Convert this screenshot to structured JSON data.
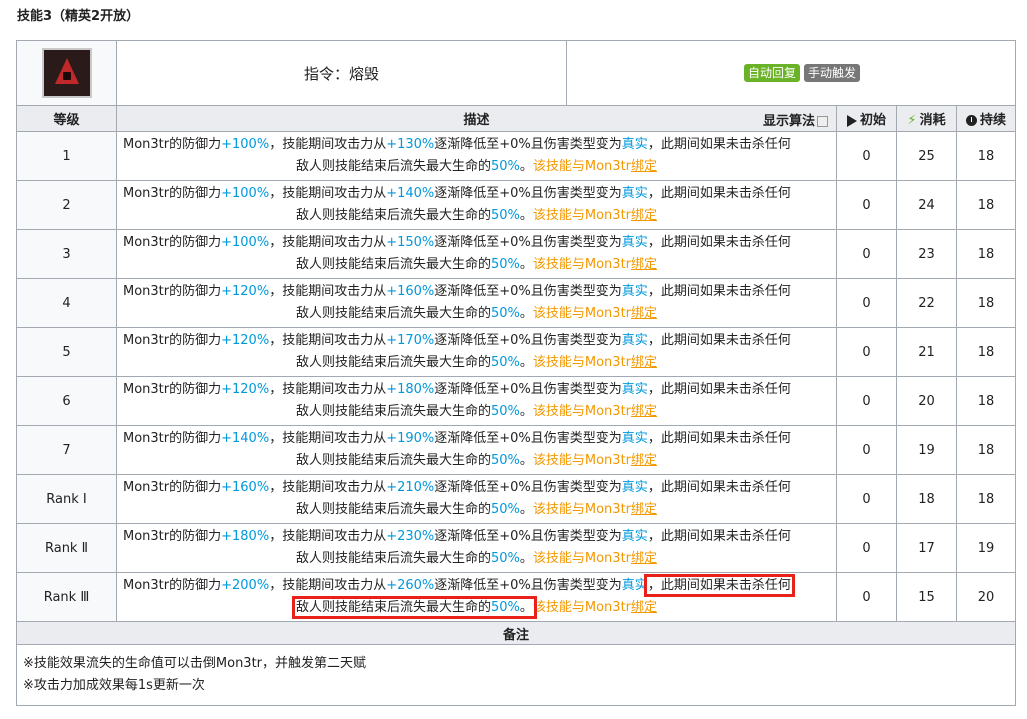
{
  "heading": "技能3（精英2开放）",
  "skill": {
    "name": "指令：熔毁",
    "tags": [
      "自动回复",
      "手动触发"
    ],
    "icon": "skill-meltdown-icon"
  },
  "columns": {
    "level": "等级",
    "description": "描述",
    "algo": "显示算法",
    "initial": "初始",
    "cost": "消耗",
    "duration": "持续"
  },
  "desc_parts": {
    "p1": "Mon3tr的防御力",
    "p2": "，技能期间攻击力从",
    "p3": "逐渐降低至+0%且伤害类型变为",
    "true_dmg": "真实",
    "p4": "，此期间如果未击杀任何",
    "p5": "敌人则技能结束后流失最大生命的",
    "pct": "50%",
    "p6": "。",
    "p7": "该技能与Mon3tr",
    "bind": "绑定"
  },
  "rows": [
    {
      "level": "1",
      "def": "+100%",
      "atk": "+130%",
      "initial": "0",
      "cost": "25",
      "duration": "18"
    },
    {
      "level": "2",
      "def": "+100%",
      "atk": "+140%",
      "initial": "0",
      "cost": "24",
      "duration": "18"
    },
    {
      "level": "3",
      "def": "+100%",
      "atk": "+150%",
      "initial": "0",
      "cost": "23",
      "duration": "18"
    },
    {
      "level": "4",
      "def": "+120%",
      "atk": "+160%",
      "initial": "0",
      "cost": "22",
      "duration": "18"
    },
    {
      "level": "5",
      "def": "+120%",
      "atk": "+170%",
      "initial": "0",
      "cost": "21",
      "duration": "18"
    },
    {
      "level": "6",
      "def": "+120%",
      "atk": "+180%",
      "initial": "0",
      "cost": "20",
      "duration": "18"
    },
    {
      "level": "7",
      "def": "+140%",
      "atk": "+190%",
      "initial": "0",
      "cost": "19",
      "duration": "18"
    },
    {
      "level": "Rank Ⅰ",
      "def": "+160%",
      "atk": "+210%",
      "initial": "0",
      "cost": "18",
      "duration": "18"
    },
    {
      "level": "Rank Ⅱ",
      "def": "+180%",
      "atk": "+230%",
      "initial": "0",
      "cost": "17",
      "duration": "19"
    },
    {
      "level": "Rank Ⅲ",
      "def": "+200%",
      "atk": "+260%",
      "initial": "0",
      "cost": "15",
      "duration": "20"
    }
  ],
  "notes_label": "备注",
  "notes": [
    "※技能效果流失的生命值可以击倒Mon3tr，并触发第二天赋",
    "※攻击力加成效果每1s更新一次"
  ],
  "highlight_color": "#e8221b"
}
